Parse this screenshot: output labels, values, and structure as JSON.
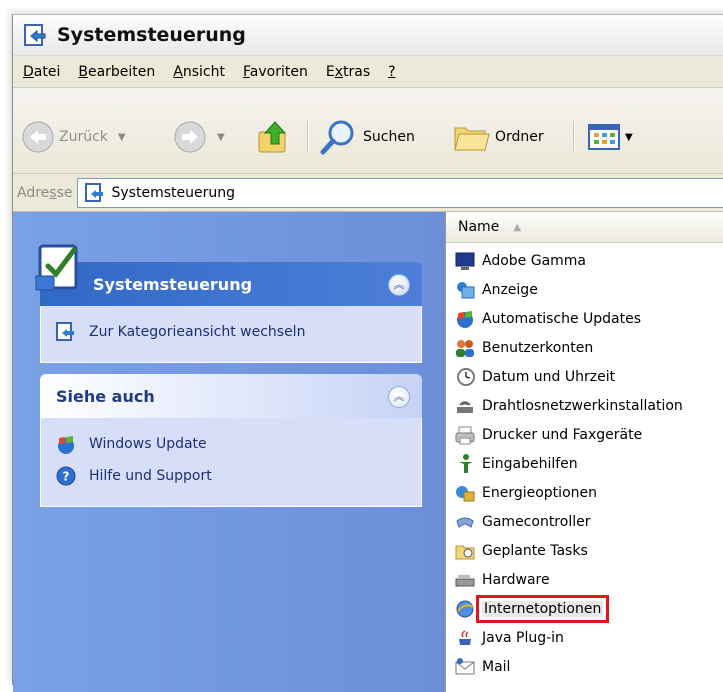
{
  "window": {
    "title": "Systemsteuerung"
  },
  "menu": [
    {
      "pre": "",
      "acc": "D",
      "post": "atei"
    },
    {
      "pre": "",
      "acc": "B",
      "post": "earbeiten"
    },
    {
      "pre": "",
      "acc": "A",
      "post": "nsicht"
    },
    {
      "pre": "",
      "acc": "F",
      "post": "avoriten"
    },
    {
      "pre": "E",
      "acc": "x",
      "post": "tras"
    },
    {
      "pre": "",
      "acc": "?",
      "post": ""
    }
  ],
  "toolbar": {
    "back_label": "Zurück",
    "search_label": "Suchen",
    "folders_label": "Ordner"
  },
  "address": {
    "label_pre": "Adre",
    "label_acc": "s",
    "label_post": "se",
    "value": "Systemsteuerung"
  },
  "taskpane": {
    "panel1": {
      "title": "Systemsteuerung",
      "links": [
        "Zur Kategorieansicht wechseln"
      ]
    },
    "panel2": {
      "title": "Siehe auch",
      "links": [
        "Windows Update",
        "Hilfe und Support"
      ]
    }
  },
  "list": {
    "column": "Name",
    "items": [
      {
        "label": "Adobe Gamma",
        "icon": "monitor-icon"
      },
      {
        "label": "Anzeige",
        "icon": "display-icon"
      },
      {
        "label": "Automatische Updates",
        "icon": "globe-shield-icon"
      },
      {
        "label": "Benutzerkonten",
        "icon": "users-icon"
      },
      {
        "label": "Datum und Uhrzeit",
        "icon": "clock-icon"
      },
      {
        "label": "Drahtlosnetzwerkinstallation",
        "icon": "wireless-icon"
      },
      {
        "label": "Drucker und Faxgeräte",
        "icon": "printer-icon"
      },
      {
        "label": "Eingabehilfen",
        "icon": "accessibility-icon"
      },
      {
        "label": "Energieoptionen",
        "icon": "power-icon"
      },
      {
        "label": "Gamecontroller",
        "icon": "gamepad-icon"
      },
      {
        "label": "Geplante Tasks",
        "icon": "folder-clock-icon"
      },
      {
        "label": "Hardware",
        "icon": "hardware-icon"
      },
      {
        "label": "Internetoptionen",
        "icon": "internet-icon",
        "selected": true
      },
      {
        "label": "Java Plug-in",
        "icon": "java-icon"
      },
      {
        "label": "Mail",
        "icon": "mail-icon"
      }
    ]
  },
  "colors": {
    "taskpane_bg": "#7aa1e6",
    "highlight_box": "#e4141e",
    "panel_body": "#d6dff7"
  }
}
